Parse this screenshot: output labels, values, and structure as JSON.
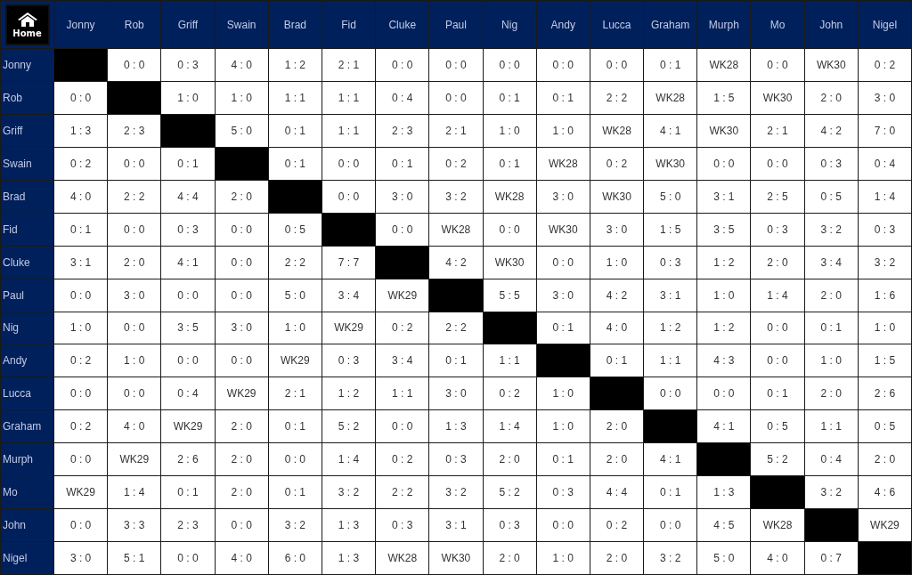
{
  "home_button": {
    "label": "Home"
  },
  "columns": [
    "Jonny",
    "Rob",
    "Griff",
    "Swain",
    "Brad",
    "Fid",
    "Cluke",
    "Paul",
    "Nig",
    "Andy",
    "Lucca",
    "Graham",
    "Murph",
    "Mo",
    "John",
    "Nigel"
  ],
  "rows": [
    {
      "name": "Jonny",
      "cells": [
        null,
        "0 : 0",
        "0 : 3",
        "4 : 0",
        "1 : 2",
        "2 : 1",
        "0 : 0",
        "0 : 0",
        "0 : 0",
        "0 : 0",
        "0 : 0",
        "0 : 1",
        "WK28",
        "0 : 0",
        "WK30",
        "0 : 2"
      ]
    },
    {
      "name": "Rob",
      "cells": [
        "0 : 0",
        null,
        "1 : 0",
        "1 : 0",
        "1 : 1",
        "1 : 1",
        "0 : 4",
        "0 : 0",
        "0 : 1",
        "0 : 1",
        "2 : 2",
        "WK28",
        "1 : 5",
        "WK30",
        "2 : 0",
        "3 : 0"
      ]
    },
    {
      "name": "Griff",
      "cells": [
        "1 : 3",
        "2 : 3",
        null,
        "5 : 0",
        "0 : 1",
        "1 : 1",
        "2 : 3",
        "2 : 1",
        "1 : 0",
        "1 : 0",
        "WK28",
        "4 : 1",
        "WK30",
        "2 : 1",
        "4 : 2",
        "7 : 0"
      ]
    },
    {
      "name": "Swain",
      "cells": [
        "0 : 2",
        "0 : 0",
        "0 : 1",
        null,
        "0 : 1",
        "0 : 0",
        "0 : 1",
        "0 : 2",
        "0 : 1",
        "WK28",
        "0 : 2",
        "WK30",
        "0 : 0",
        "0 : 0",
        "0 : 3",
        "0 : 4"
      ]
    },
    {
      "name": "Brad",
      "cells": [
        "4 : 0",
        "2 : 2",
        "4 : 4",
        "2 : 0",
        null,
        "0 : 0",
        "3 : 0",
        "3 : 2",
        "WK28",
        "3 : 0",
        "WK30",
        "5 : 0",
        "3 : 1",
        "2 : 5",
        "0 : 5",
        "1 : 4"
      ]
    },
    {
      "name": "Fid",
      "cells": [
        "0 : 1",
        "0 : 0",
        "0 : 3",
        "0 : 0",
        "0 : 5",
        null,
        "0 : 0",
        "WK28",
        "0 : 0",
        "WK30",
        "3 : 0",
        "1 : 5",
        "3 : 5",
        "0 : 3",
        "3 : 2",
        "0 : 3"
      ]
    },
    {
      "name": "Cluke",
      "cells": [
        "3 : 1",
        "2 : 0",
        "4 : 1",
        "0 : 0",
        "2 : 2",
        "7 : 7",
        null,
        "4 : 2",
        "WK30",
        "0 : 0",
        "1 : 0",
        "0 : 3",
        "1 : 2",
        "2 : 0",
        "3 : 4",
        "3 : 2"
      ]
    },
    {
      "name": "Paul",
      "cells": [
        "0 : 0",
        "3 : 0",
        "0 : 0",
        "0 : 0",
        "5 : 0",
        "3 : 4",
        "WK29",
        null,
        "5 : 5",
        "3 : 0",
        "4 : 2",
        "3 : 1",
        "1 : 0",
        "1 : 4",
        "2 : 0",
        "1 : 6"
      ]
    },
    {
      "name": "Nig",
      "cells": [
        "1 : 0",
        "0 : 0",
        "3 : 5",
        "3 : 0",
        "1 : 0",
        "WK29",
        "0 : 2",
        "2 : 2",
        null,
        "0 : 1",
        "4 : 0",
        "1 : 2",
        "1 : 2",
        "0 : 0",
        "0 : 1",
        "1 : 0"
      ]
    },
    {
      "name": "Andy",
      "cells": [
        "0 : 2",
        "1 : 0",
        "0 : 0",
        "0 : 0",
        "WK29",
        "0 : 3",
        "3 : 4",
        "0 : 1",
        "1 : 1",
        null,
        "0 : 1",
        "1 : 1",
        "4 : 3",
        "0 : 0",
        "1 : 0",
        "1 : 5"
      ]
    },
    {
      "name": "Lucca",
      "cells": [
        "0 : 0",
        "0 : 0",
        "0 : 4",
        "WK29",
        "2 : 1",
        "1 : 2",
        "1 : 1",
        "3 : 0",
        "0 : 2",
        "1 : 0",
        null,
        "0 : 0",
        "0 : 0",
        "0 : 1",
        "2 : 0",
        "2 : 6"
      ]
    },
    {
      "name": "Graham",
      "cells": [
        "0 : 2",
        "4 : 0",
        "WK29",
        "2 : 0",
        "0 : 1",
        "5 : 2",
        "0 : 0",
        "1 : 3",
        "1 : 4",
        "1 : 0",
        "2 : 0",
        null,
        "4 : 1",
        "0 : 5",
        "1 : 1",
        "0 : 5"
      ]
    },
    {
      "name": "Murph",
      "cells": [
        "0 : 0",
        "WK29",
        "2 : 6",
        "2 : 0",
        "0 : 0",
        "1 : 4",
        "0 : 2",
        "0 : 3",
        "2 : 0",
        "0 : 1",
        "2 : 0",
        "4 : 1",
        null,
        "5 : 2",
        "0 : 4",
        "2 : 0"
      ]
    },
    {
      "name": "Mo",
      "cells": [
        "WK29",
        "1 : 4",
        "0 : 1",
        "2 : 0",
        "0 : 1",
        "3 : 2",
        "2 : 2",
        "3 : 2",
        "5 : 2",
        "0 : 3",
        "4 : 4",
        "0 : 1",
        "1 : 3",
        null,
        "3 : 2",
        "4 : 6"
      ]
    },
    {
      "name": "John",
      "cells": [
        "0 : 0",
        "3 : 3",
        "2 : 3",
        "0 : 0",
        "3 : 2",
        "1 : 3",
        "0 : 3",
        "3 : 1",
        "0 : 3",
        "0 : 0",
        "0 : 2",
        "0 : 0",
        "4 : 5",
        "WK28",
        null,
        "WK29"
      ]
    },
    {
      "name": "Nigel",
      "cells": [
        "3 : 0",
        "5 : 1",
        "0 : 0",
        "4 : 0",
        "6 : 0",
        "1 : 3",
        "WK28",
        "WK30",
        "2 : 0",
        "1 : 0",
        "2 : 0",
        "3 : 2",
        "5 : 0",
        "4 : 0",
        "0 : 7",
        null
      ]
    }
  ]
}
